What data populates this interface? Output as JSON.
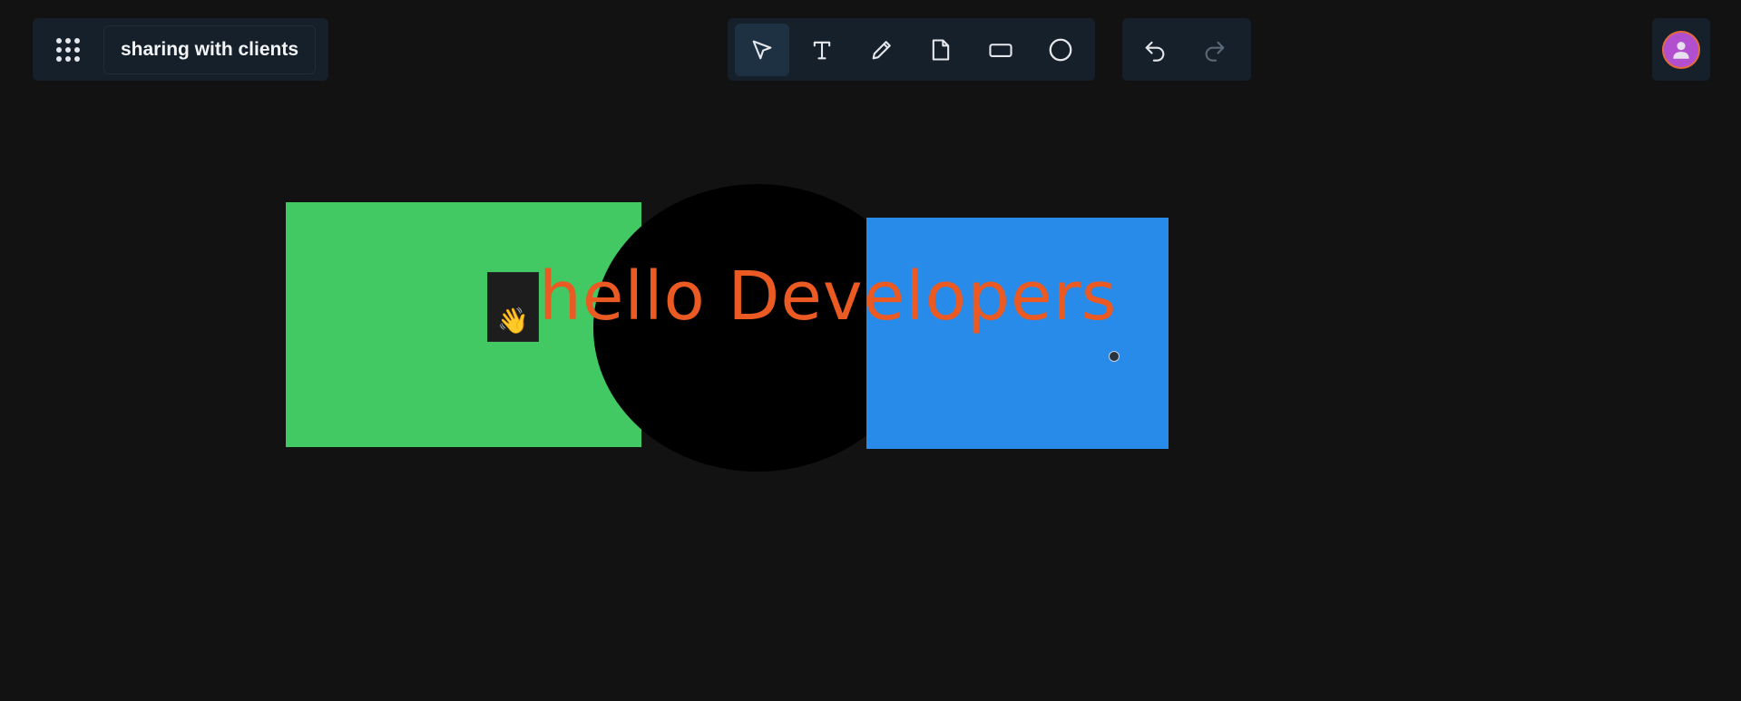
{
  "app": {
    "board_title": "sharing with clients"
  },
  "toolbar": {
    "tools": [
      {
        "name": "select",
        "icon": "cursor-arrow-icon",
        "active": true
      },
      {
        "name": "text",
        "icon": "text-icon",
        "active": false
      },
      {
        "name": "pencil",
        "icon": "pencil-icon",
        "active": false
      },
      {
        "name": "note",
        "icon": "sticky-note-icon",
        "active": false
      },
      {
        "name": "rectangle",
        "icon": "rectangle-icon",
        "active": false
      },
      {
        "name": "ellipse",
        "icon": "circle-icon",
        "active": false
      }
    ],
    "history": [
      {
        "name": "undo",
        "icon": "undo-icon",
        "enabled": true
      },
      {
        "name": "redo",
        "icon": "redo-icon",
        "enabled": false
      }
    ]
  },
  "user": {
    "avatar_icon": "user-avatar-icon",
    "avatar_color": "#b24fcf"
  },
  "canvas": {
    "background": "#121212",
    "shapes": [
      {
        "type": "rectangle",
        "color": "#42c963"
      },
      {
        "type": "ellipse",
        "color": "#000000"
      },
      {
        "type": "rectangle",
        "color": "#288be9"
      }
    ],
    "emoji": "👋",
    "text": "hello Developers",
    "text_color": "#ea5a22"
  }
}
